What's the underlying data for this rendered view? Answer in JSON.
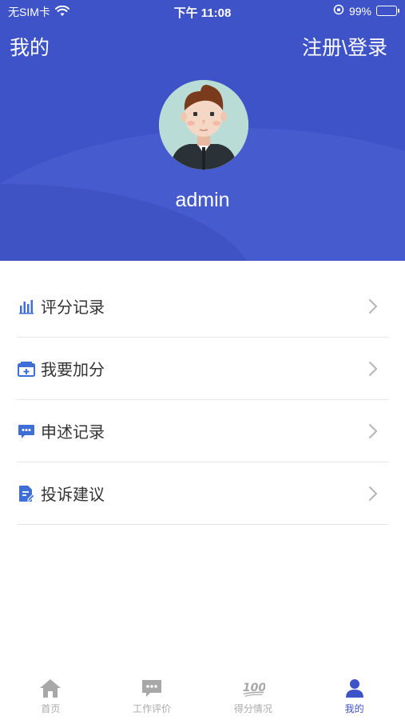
{
  "status_bar": {
    "carrier": "无SIM卡",
    "time": "下午 11:08",
    "battery": "99%"
  },
  "header": {
    "title": "我的",
    "login_link": "注册\\登录",
    "username": "admin"
  },
  "menu": [
    {
      "label": "评分记录",
      "icon": "bar-chart-icon"
    },
    {
      "label": "我要加分",
      "icon": "add-score-icon"
    },
    {
      "label": "申述记录",
      "icon": "chat-bubble-icon"
    },
    {
      "label": "投诉建议",
      "icon": "document-edit-icon"
    }
  ],
  "tabs": [
    {
      "label": "首页",
      "icon": "home-icon",
      "active": false
    },
    {
      "label": "工作评价",
      "icon": "message-icon",
      "active": false
    },
    {
      "label": "得分情况",
      "icon": "score-100-icon",
      "active": false
    },
    {
      "label": "我的",
      "icon": "user-icon",
      "active": true
    }
  ],
  "colors": {
    "primary": "#3f53c8",
    "menu_icon": "#3f6fd6",
    "tab_inactive": "#aaaaaa"
  }
}
